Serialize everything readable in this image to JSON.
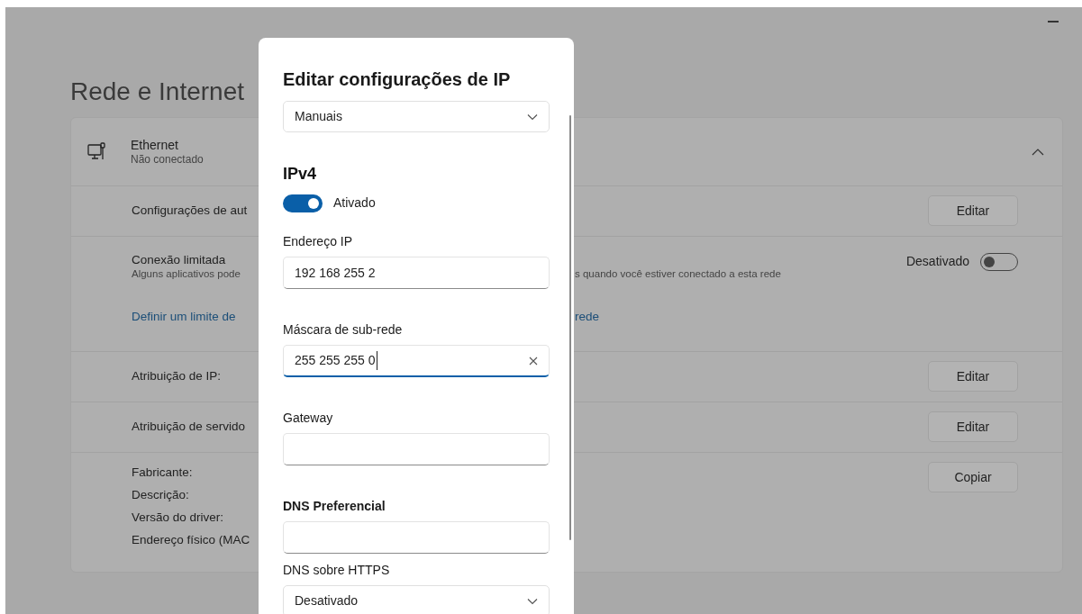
{
  "page_title": "Rede e Internet",
  "ethernet": {
    "name": "Ethernet",
    "status": "Não conectado",
    "expanded": true
  },
  "settings_rows": [
    {
      "kind": "button",
      "label": "Configurações de aut",
      "button": "Editar"
    },
    {
      "kind": "toggle",
      "label": "Conexão limitada",
      "description": "Alguns aplicativos pode",
      "description_after": "s quando você estiver conectado a esta rede",
      "toggle_label": "Desativado",
      "on": false,
      "link": "Definir um limite de",
      "link_after": "rede"
    },
    {
      "kind": "button",
      "label": "Atribuição de IP:",
      "button": "Editar"
    },
    {
      "kind": "button",
      "label": "Atribuição de servido",
      "button": "Editar"
    },
    {
      "kind": "details",
      "labels": [
        "Fabricante:",
        "Descrição:",
        "Versão do driver:",
        "Endereço físico (MAC"
      ],
      "button": "Copiar"
    }
  ],
  "dialog": {
    "title": "Editar configurações de IP",
    "mode": "Manuais",
    "section": "IPv4",
    "ipv4": {
      "on": true,
      "label": "Ativado"
    },
    "fields": [
      {
        "kind": "text",
        "label": "Endereço IP",
        "value": "192 168 255 2",
        "focused": false,
        "bold": false
      },
      {
        "kind": "text",
        "label": "Máscara de sub-rede",
        "value": "255 255 255 0",
        "focused": true,
        "bold": false
      },
      {
        "kind": "text",
        "label": "Gateway",
        "focused": false,
        "bold": false
      },
      {
        "kind": "text",
        "label": "DNS Preferencial",
        "focused": false,
        "bold": true
      },
      {
        "kind": "dropdown",
        "label": "DNS sobre HTTPS",
        "value": "Desativado"
      }
    ]
  }
}
